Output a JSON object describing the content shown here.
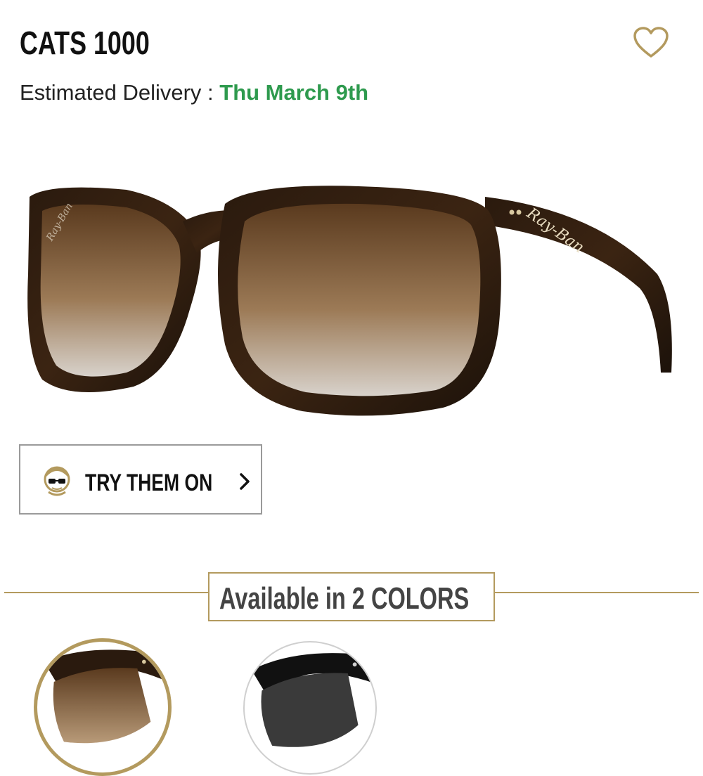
{
  "product": {
    "name": "CATS 1000",
    "delivery_label": "Estimated Delivery : ",
    "delivery_date": "Thu March 9th",
    "brand_mark": "Ray-Ban"
  },
  "try_on": {
    "label": "TRY THEM ON",
    "icon": "face-with-glasses-icon"
  },
  "colors": {
    "heading": "Available in 2 COLORS",
    "options": [
      {
        "name": "tortoise-brown-gradient",
        "selected": true
      },
      {
        "name": "black-grey",
        "selected": false
      }
    ]
  },
  "theme": {
    "accent": "#b39a5e",
    "delivery_green": "#2e9a4e"
  }
}
